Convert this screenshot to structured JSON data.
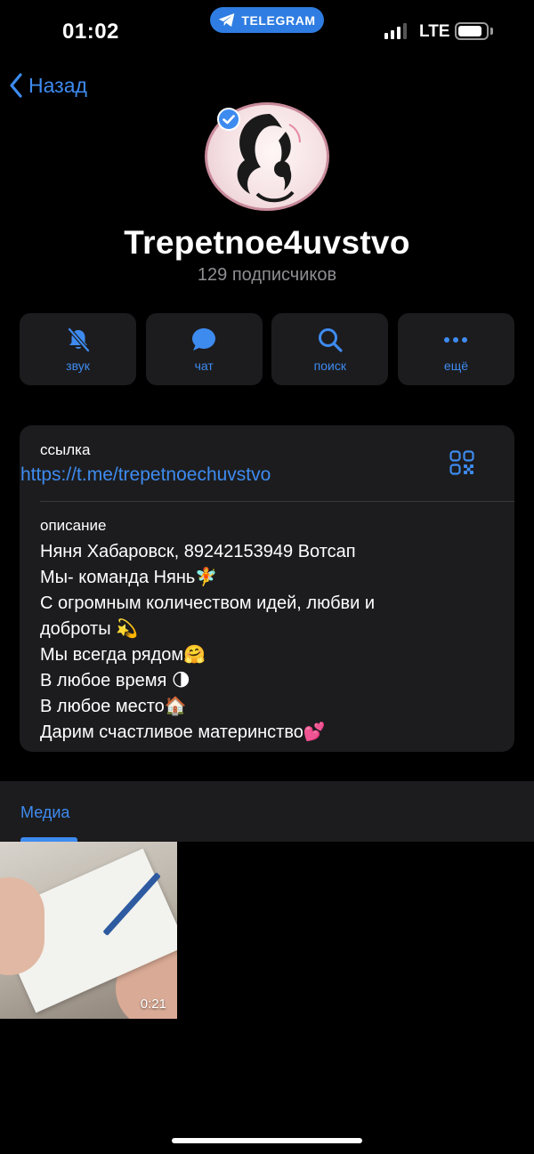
{
  "status_bar": {
    "time": "01:02",
    "app_pill": "TELEGRAM",
    "network": "LTE",
    "signal_bars": 3,
    "battery_level": 0.85
  },
  "nav": {
    "back_label": "Назад"
  },
  "channel": {
    "name": "Trepetnoe4uvstvo",
    "subscribers": "129 подписчиков",
    "verified": true
  },
  "actions": [
    {
      "label": "звук",
      "icon": "bell-slash-icon"
    },
    {
      "label": "чат",
      "icon": "chat-bubble-icon"
    },
    {
      "label": "поиск",
      "icon": "search-icon"
    },
    {
      "label": "ещё",
      "icon": "more-dots-icon"
    }
  ],
  "info": {
    "link_caption": "ссылка",
    "link": "https://t.me/trepetnoechuvstvo",
    "description_caption": "описание",
    "description_lines": [
      "Няня Хабаровск, 89242153949 Вотсап",
      "Мы- команда Нянь🧚",
      "С огромным количеством идей, любви и",
      "доброты 💫",
      "Мы всегда рядом🤗",
      "В любое время 🌗",
      "В любое место🏠",
      "Дарим счастливое материнство💕"
    ]
  },
  "media": {
    "tab_label": "Медиа",
    "items": [
      {
        "type": "video",
        "duration": "0:21"
      }
    ]
  },
  "colors": {
    "accent": "#3e8bf0",
    "card": "#1c1c1e",
    "background": "#000000",
    "secondary_text": "#8e8e93"
  }
}
